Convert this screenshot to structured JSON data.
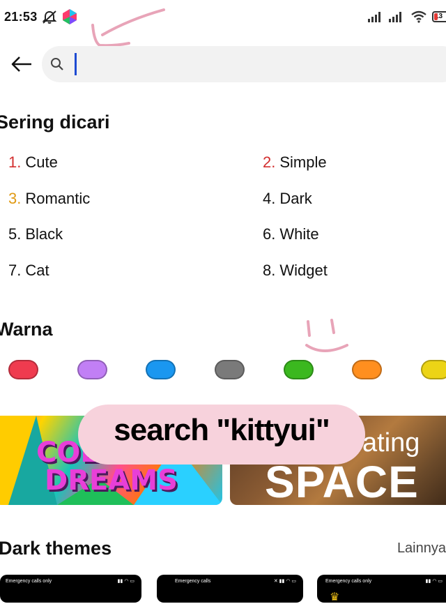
{
  "status_bar": {
    "time": "21:53",
    "battery": "13"
  },
  "search": {
    "placeholder": ""
  },
  "popular": {
    "title": "Sering dicari",
    "items": [
      {
        "num": "1.",
        "label": "Cute",
        "color": "#d32f2f"
      },
      {
        "num": "2.",
        "label": "Simple",
        "color": "#d32f2f"
      },
      {
        "num": "3.",
        "label": "Romantic",
        "color": "#e09a14"
      },
      {
        "num": "4.",
        "label": "Dark",
        "color": "#111111"
      },
      {
        "num": "5.",
        "label": "Black",
        "color": "#111111"
      },
      {
        "num": "6.",
        "label": "White",
        "color": "#111111"
      },
      {
        "num": "7.",
        "label": "Cat",
        "color": "#111111"
      },
      {
        "num": "8.",
        "label": "Widget",
        "color": "#111111"
      }
    ]
  },
  "colors": {
    "title": "Warna",
    "swatches": [
      "#ef3b4f",
      "#c17ff5",
      "#1a97f0",
      "#7a7a7a",
      "#3bb81f",
      "#ff8f1f",
      "#ecd416"
    ]
  },
  "banners": [
    {
      "line1": "COLOR",
      "line2": "DREAMS"
    },
    {
      "line1": "ating",
      "line2": "SPACE"
    }
  ],
  "overlay": {
    "text": "search \"kittyui\""
  },
  "dark_themes": {
    "title": "Dark themes",
    "more": "Lainnya",
    "thumbs": [
      {
        "status": "Emergency calls only"
      },
      {
        "status": "Emergency calls"
      },
      {
        "status": "Emergency calls only"
      }
    ]
  }
}
